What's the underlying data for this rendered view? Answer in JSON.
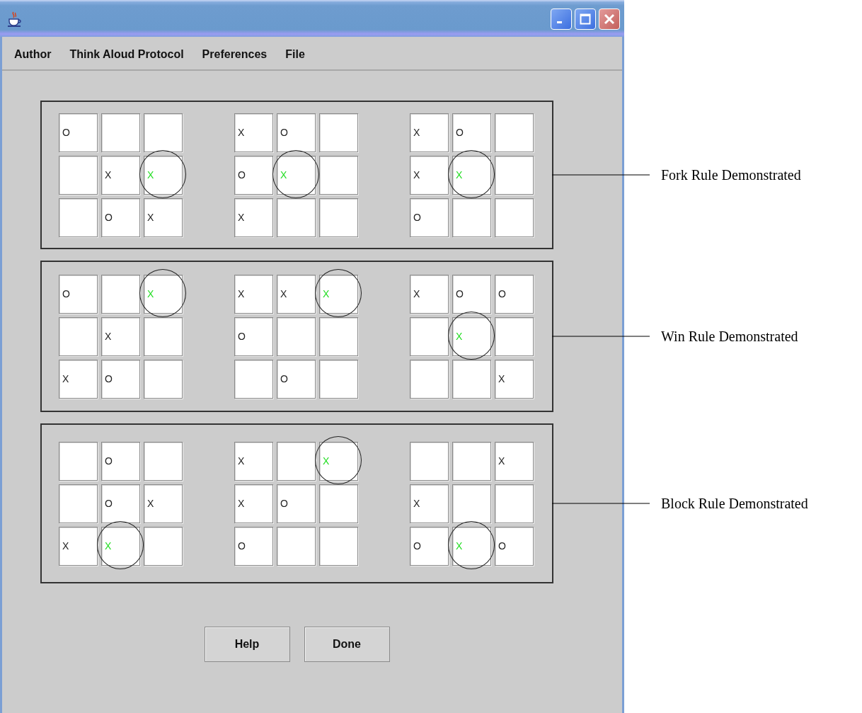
{
  "menu": [
    "Author",
    "Think Aloud Protocol",
    "Preferences",
    "File"
  ],
  "panels": [
    {
      "label": "Fork Rule Demonstrated",
      "boards": [
        [
          {
            "mark": "O",
            "highlighted": false
          },
          {
            "highlighted": false
          },
          {
            "highlighted": false
          },
          {
            "highlighted": false
          },
          {
            "mark": "X",
            "highlighted": false
          },
          {
            "mark": "X",
            "highlighted": true
          },
          {
            "highlighted": false
          },
          {
            "mark": "O",
            "highlighted": false
          },
          {
            "mark": "X",
            "highlighted": false
          }
        ],
        [
          {
            "mark": "X",
            "highlighted": false
          },
          {
            "mark": "O",
            "highlighted": false
          },
          {
            "highlighted": false
          },
          {
            "mark": "O",
            "highlighted": false
          },
          {
            "mark": "X",
            "highlighted": true
          },
          {
            "highlighted": false
          },
          {
            "mark": "X",
            "highlighted": false
          },
          {
            "highlighted": false
          },
          {
            "highlighted": false
          }
        ],
        [
          {
            "mark": "X",
            "highlighted": false
          },
          {
            "mark": "O",
            "highlighted": false
          },
          {
            "highlighted": false
          },
          {
            "mark": "X",
            "highlighted": false
          },
          {
            "mark": "X",
            "highlighted": true
          },
          {
            "highlighted": false
          },
          {
            "mark": "O",
            "highlighted": false
          },
          {
            "highlighted": false
          },
          {
            "highlighted": false
          }
        ]
      ]
    },
    {
      "label": "Win Rule Demonstrated",
      "boards": [
        [
          {
            "mark": "O",
            "highlighted": false
          },
          {
            "highlighted": false
          },
          {
            "mark": "X",
            "highlighted": true
          },
          {
            "highlighted": false
          },
          {
            "mark": "X",
            "highlighted": false
          },
          {
            "highlighted": false
          },
          {
            "mark": "X",
            "highlighted": false
          },
          {
            "mark": "O",
            "highlighted": false
          },
          {
            "highlighted": false
          }
        ],
        [
          {
            "mark": "X",
            "highlighted": false
          },
          {
            "mark": "X",
            "highlighted": false
          },
          {
            "mark": "X",
            "highlighted": true
          },
          {
            "mark": "O",
            "highlighted": false
          },
          {
            "highlighted": false
          },
          {
            "highlighted": false
          },
          {
            "highlighted": false
          },
          {
            "mark": "O",
            "highlighted": false
          },
          {
            "highlighted": false
          }
        ],
        [
          {
            "mark": "X",
            "highlighted": false
          },
          {
            "mark": "O",
            "highlighted": false
          },
          {
            "mark": "O",
            "highlighted": false
          },
          {
            "highlighted": false
          },
          {
            "mark": "X",
            "highlighted": true
          },
          {
            "highlighted": false
          },
          {
            "highlighted": false
          },
          {
            "highlighted": false
          },
          {
            "mark": "X",
            "highlighted": false
          }
        ]
      ]
    },
    {
      "label": "Block Rule Demonstrated",
      "boards": [
        [
          {
            "highlighted": false
          },
          {
            "mark": "O",
            "highlighted": false
          },
          {
            "highlighted": false
          },
          {
            "highlighted": false
          },
          {
            "mark": "O",
            "highlighted": false
          },
          {
            "mark": "X",
            "highlighted": false
          },
          {
            "mark": "X",
            "highlighted": false
          },
          {
            "mark": "X",
            "highlighted": true
          },
          {
            "highlighted": false
          }
        ],
        [
          {
            "mark": "X",
            "highlighted": false
          },
          {
            "highlighted": false
          },
          {
            "mark": "X",
            "highlighted": true
          },
          {
            "mark": "X",
            "highlighted": false
          },
          {
            "mark": "O",
            "highlighted": false
          },
          {
            "highlighted": false
          },
          {
            "mark": "O",
            "highlighted": false
          },
          {
            "highlighted": false
          },
          {
            "highlighted": false
          }
        ],
        [
          {
            "highlighted": false
          },
          {
            "highlighted": false
          },
          {
            "mark": "X",
            "highlighted": false
          },
          {
            "mark": "X",
            "highlighted": false
          },
          {
            "highlighted": false
          },
          {
            "highlighted": false
          },
          {
            "mark": "O",
            "highlighted": false
          },
          {
            "mark": "X",
            "highlighted": true
          },
          {
            "mark": "O",
            "highlighted": false
          }
        ]
      ]
    }
  ],
  "buttons": [
    "Help",
    "Done"
  ]
}
